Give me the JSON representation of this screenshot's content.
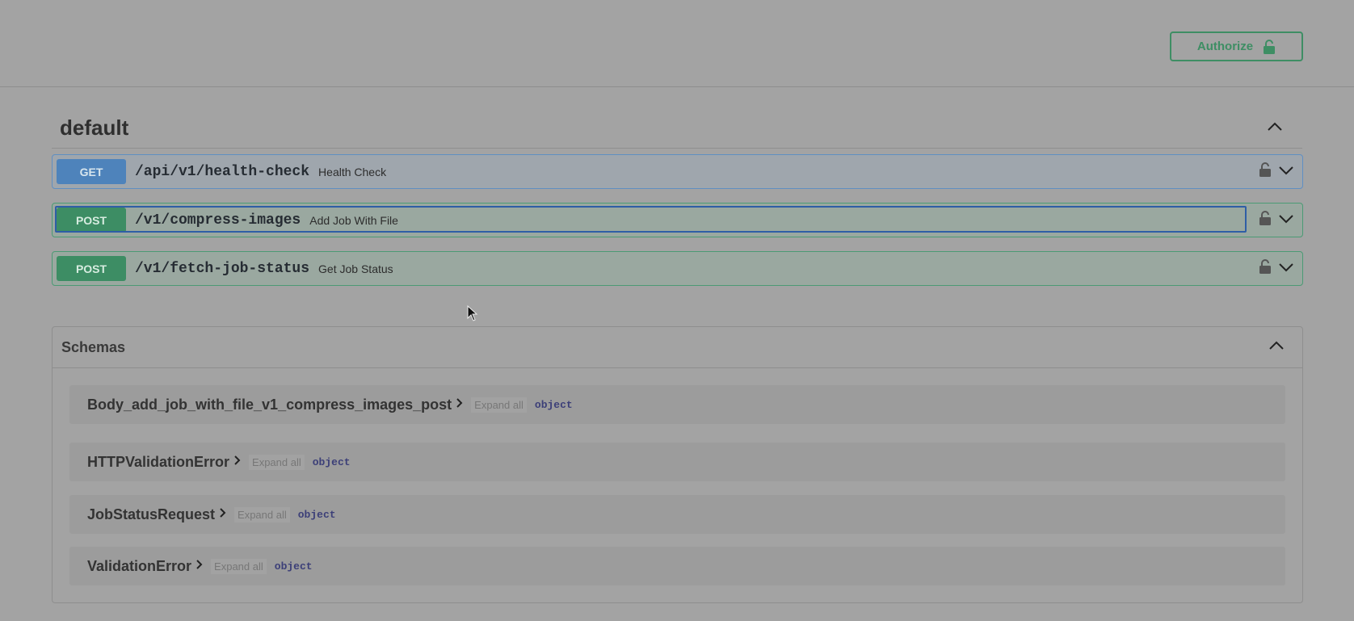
{
  "header": {
    "authorize_label": "Authorize"
  },
  "tag": {
    "name": "default"
  },
  "operations": [
    {
      "method": "GET",
      "path": "/api/v1/health-check",
      "summary": "Health Check"
    },
    {
      "method": "POST",
      "path": "/v1/compress-images",
      "summary": "Add Job With File"
    },
    {
      "method": "POST",
      "path": "/v1/fetch-job-status",
      "summary": "Get Job Status"
    }
  ],
  "schemas": {
    "title": "Schemas",
    "expand_all_label": "Expand all",
    "models": [
      {
        "name": "Body_add_job_with_file_v1_compress_images_post",
        "type": "object"
      },
      {
        "name": "HTTPValidationError",
        "type": "object"
      },
      {
        "name": "JobStatusRequest",
        "type": "object"
      },
      {
        "name": "ValidationError",
        "type": "object"
      }
    ]
  },
  "colors": {
    "get": "#4e83bb",
    "post": "#3d8d64",
    "authorize": "#3e8e64"
  }
}
